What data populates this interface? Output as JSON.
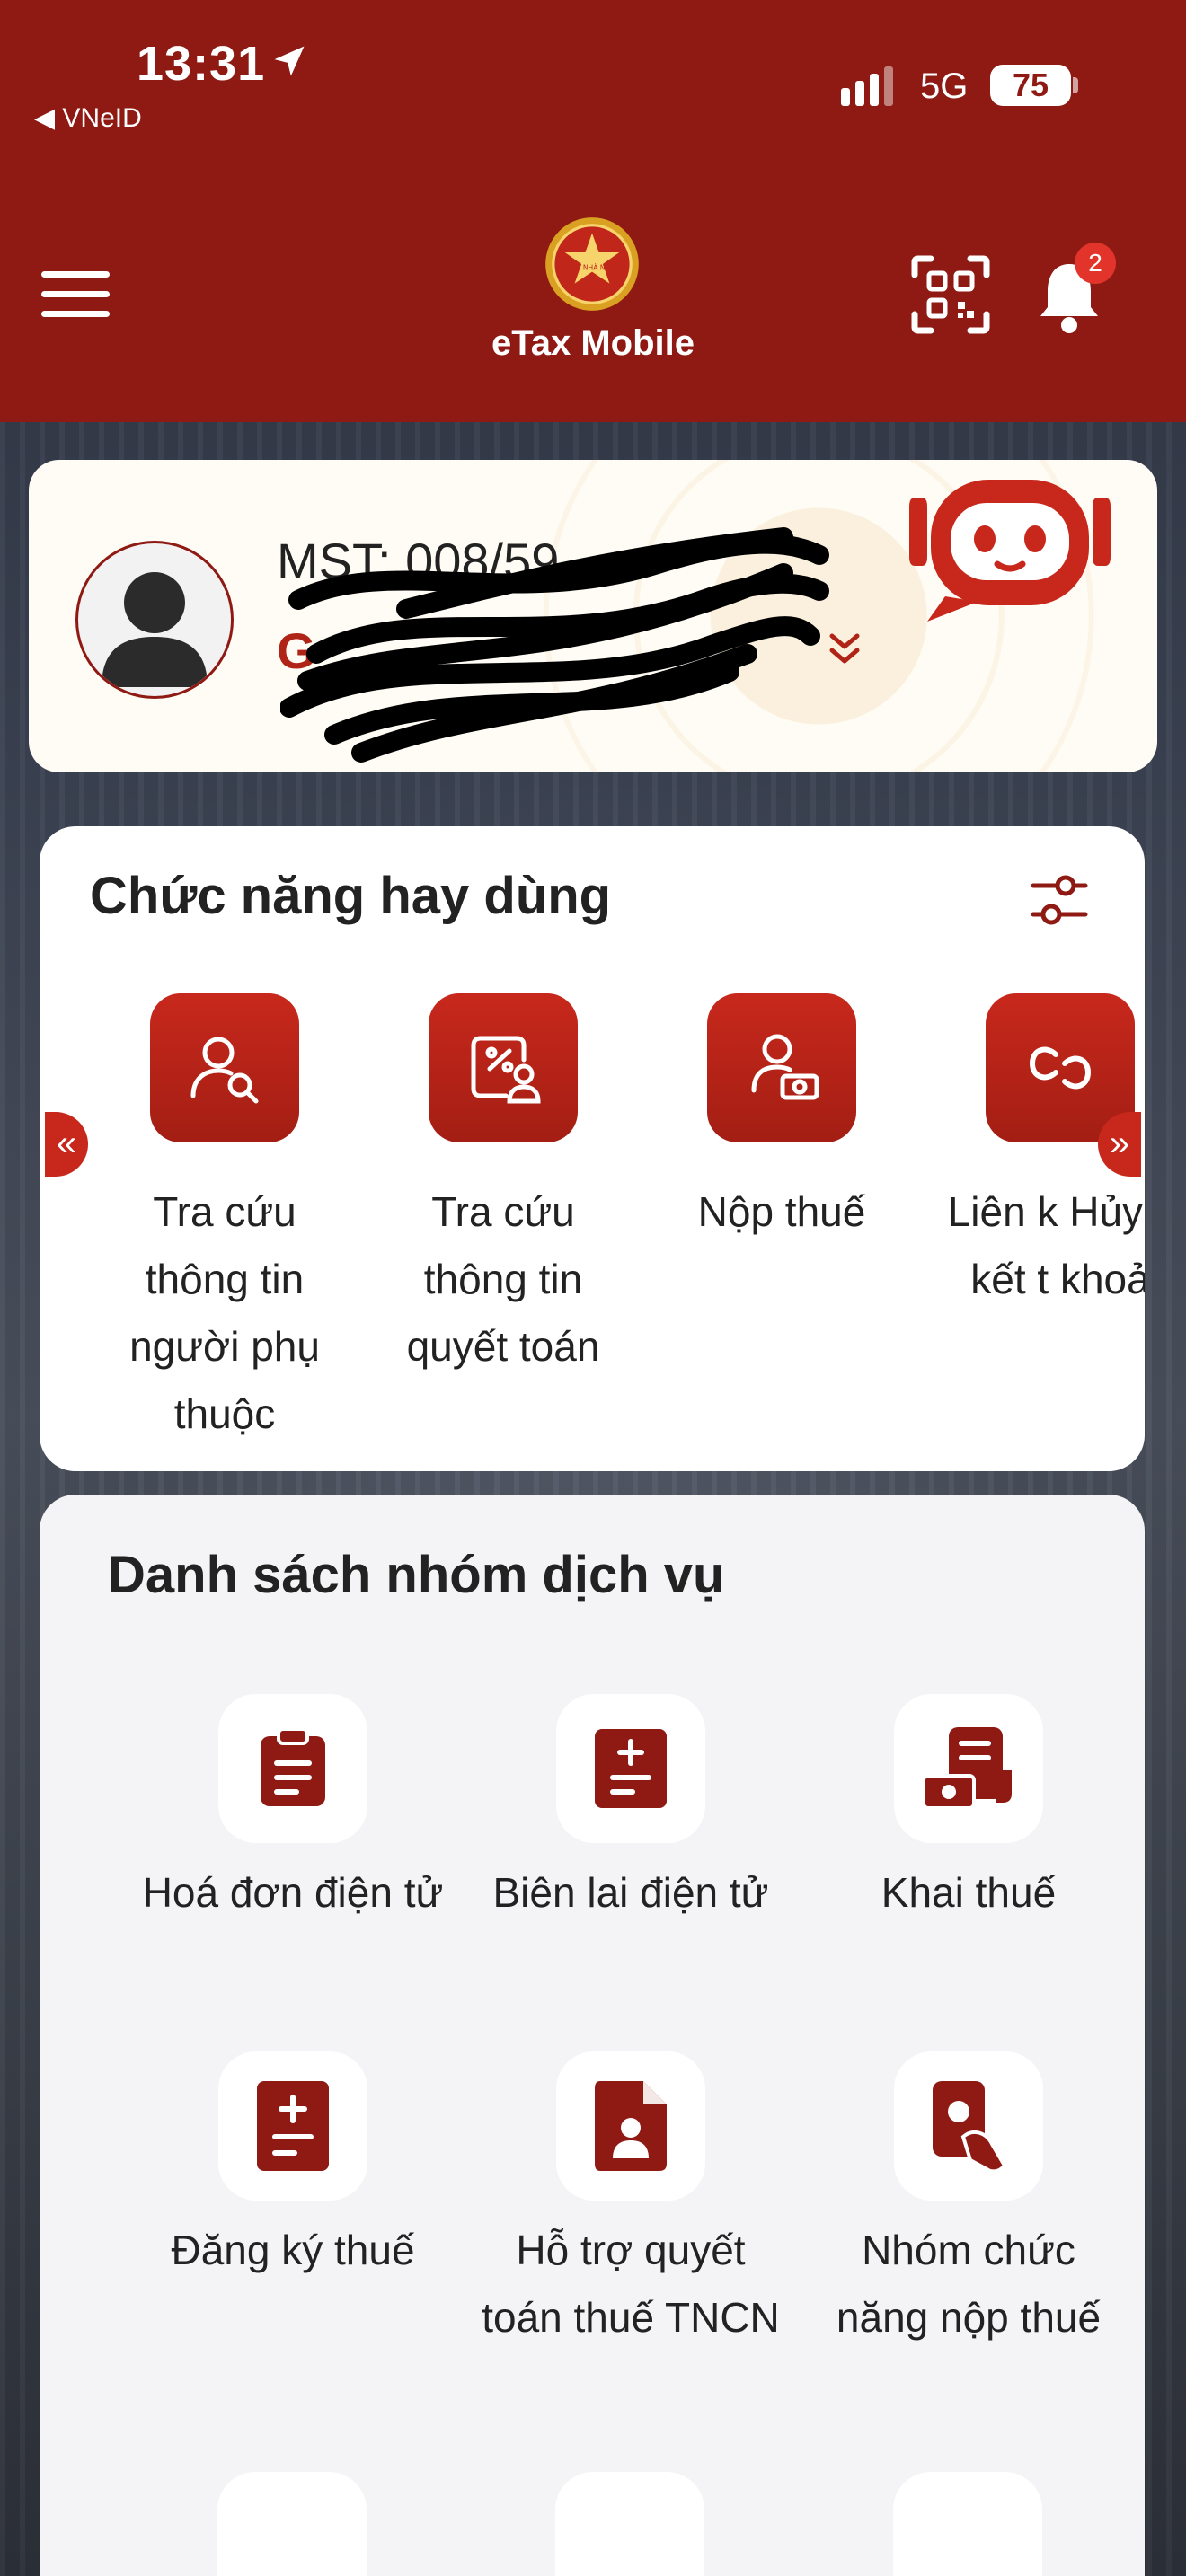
{
  "status_bar": {
    "time": "13:31",
    "back_app": "◀ VNeID",
    "network": "5G",
    "battery": "75"
  },
  "header": {
    "app_title": "eTax Mobile",
    "notification_count": "2",
    "logo_text": "THUẾ NHÀ NƯỚC"
  },
  "profile": {
    "mst_label": "MST: 0",
    "mst_visible_part": "08/",
    "mst_visible_tail": "59",
    "name_visible": "G"
  },
  "favorites": {
    "title": "Chức năng hay dùng",
    "items": [
      {
        "label": "Tra cứu thông tin người phụ thuộc",
        "icon": "person-search-icon"
      },
      {
        "label": "Tra cứu thông tin quyết toán",
        "icon": "tax-settlement-icon"
      },
      {
        "label": "Nộp thuế",
        "icon": "pay-tax-icon"
      },
      {
        "label": "Liên k Hủy li kết t khoả",
        "icon": "link-account-icon"
      }
    ],
    "prev_arrow": "«",
    "next_arrow": "»"
  },
  "services": {
    "title": "Danh sách nhóm dịch vụ",
    "items": [
      {
        "label": "Hoá đơn điện tử",
        "icon": "clipboard-invoice-icon"
      },
      {
        "label": "Biên lai điện tử",
        "icon": "receipt-plus-minus-icon"
      },
      {
        "label": "Khai thuế",
        "icon": "tax-declaration-icon"
      },
      {
        "label": "Đăng ký thuế",
        "icon": "tax-register-icon"
      },
      {
        "label": "Hỗ trợ quyết toán thuế TNCN",
        "icon": "personal-doc-icon"
      },
      {
        "label": "Nhóm chức năng nộp thuế",
        "icon": "tax-payment-group-icon"
      }
    ]
  },
  "colors": {
    "brand_red": "#8e1a13",
    "accent_red": "#c8281c",
    "badge_red": "#e2342a"
  }
}
